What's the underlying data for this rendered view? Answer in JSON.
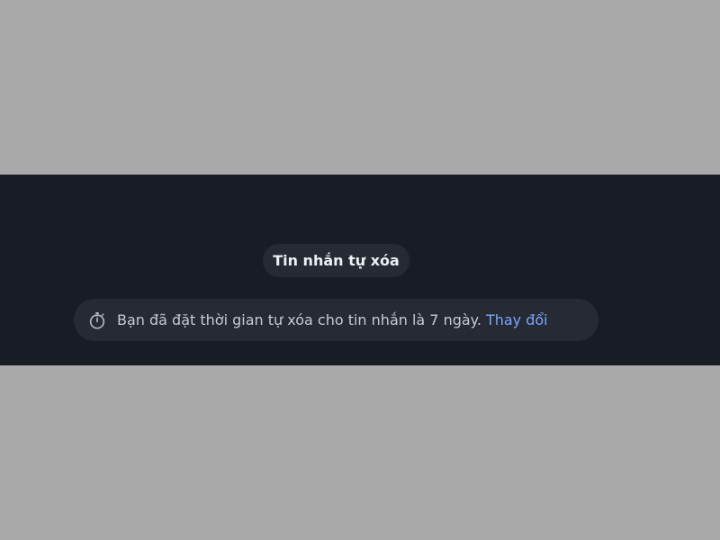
{
  "colors": {
    "background": "#a9a9a9",
    "screen": "#181c25",
    "pill": "#252a33",
    "title_text": "#eceff4",
    "notice_text": "#c6cad1",
    "link": "#7ba6ff"
  },
  "chat": {
    "title": "Tin nhắn tự xóa",
    "notice": {
      "icon": "timer-icon",
      "text": "Bạn đã đặt thời gian tự xóa cho tin nhắn là 7 ngày.",
      "action_label": "Thay đổi"
    }
  }
}
